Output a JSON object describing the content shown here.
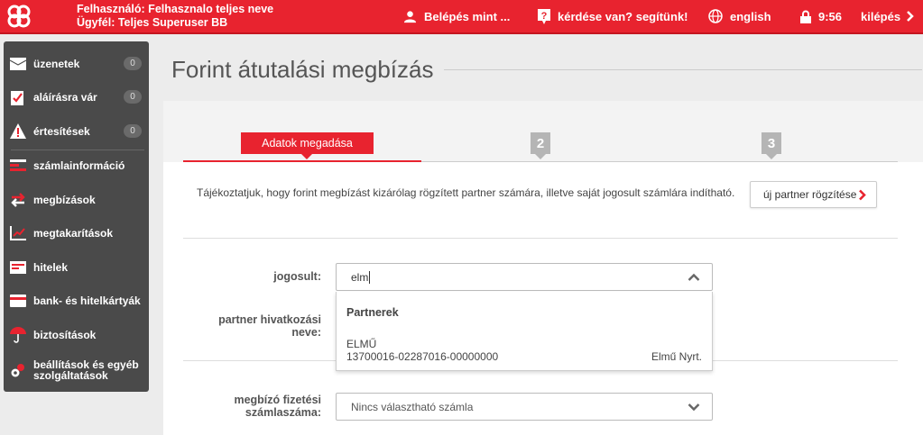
{
  "header": {
    "user_line": "Felhasználó: Felhasznalo teljes neve",
    "client_line": "Ügyfél: Teljes Superuser BB",
    "login_as": "Belépés mint ...",
    "help": "kérdése van? segítünk!",
    "language": "english",
    "timer": "9:56",
    "logout": "kilépés",
    "brand_color": "#e8232f"
  },
  "sidebar": {
    "items": [
      {
        "label": "üzenetek",
        "badge": "0",
        "icon": "envelope-icon"
      },
      {
        "label": "aláírásra vár",
        "badge": "0",
        "icon": "signature-icon"
      },
      {
        "label": "értesítések",
        "badge": "0",
        "icon": "warning-icon"
      },
      {
        "label": "számlainformáció",
        "icon": "account-info-icon"
      },
      {
        "label": "megbízások",
        "icon": "transfer-arrows-icon"
      },
      {
        "label": "megtakarítások",
        "icon": "chart-icon"
      },
      {
        "label": "hitelek",
        "icon": "credit-icon"
      },
      {
        "label": "bank- és hitelkártyák",
        "icon": "card-icon"
      },
      {
        "label": "biztosítások",
        "icon": "umbrella-icon"
      },
      {
        "label": "beállítások és egyéb szolgáltatások",
        "icon": "gear-icon"
      }
    ]
  },
  "main": {
    "title": "Forint átutalási megbízás",
    "steps": {
      "active_label": "Adatok megadása",
      "step2": "2",
      "step3": "3"
    },
    "info_text": "Tájékoztatjuk, hogy forint megbízást kizárólag rögzített partner számára, illetve saját jogosult számlára indítható.",
    "new_partner_button": "új partner rögzítése",
    "fields": {
      "jogosult_label": "jogosult:",
      "jogosult_value": "elm",
      "partner_ref_label": "partner hivatkozási neve:",
      "payer_account_label": "megbízó fizetési számlaszáma:",
      "payer_account_value": "Nincs választható számla"
    },
    "dropdown": {
      "header": "Partnerek",
      "option_name": "ELMŰ",
      "option_account": "13700016-02287016-00000000",
      "option_partner": "Elmű Nyrt."
    }
  }
}
